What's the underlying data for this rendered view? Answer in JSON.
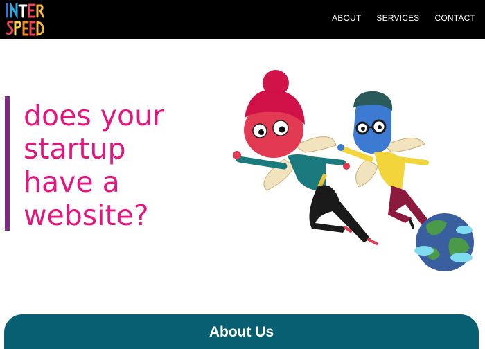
{
  "header": {
    "logo": {
      "line1": "INTER",
      "line2": "SPEED"
    },
    "nav": [
      {
        "label": "ABOUT"
      },
      {
        "label": "SERVICES"
      },
      {
        "label": "CONTACT"
      }
    ]
  },
  "hero": {
    "lines": [
      "does your",
      "startup",
      "have a",
      "website?"
    ],
    "accent_color": "#e3167f",
    "bar_color": "#7a2a83"
  },
  "about": {
    "title": "About Us",
    "bg_color": "#085f72"
  }
}
